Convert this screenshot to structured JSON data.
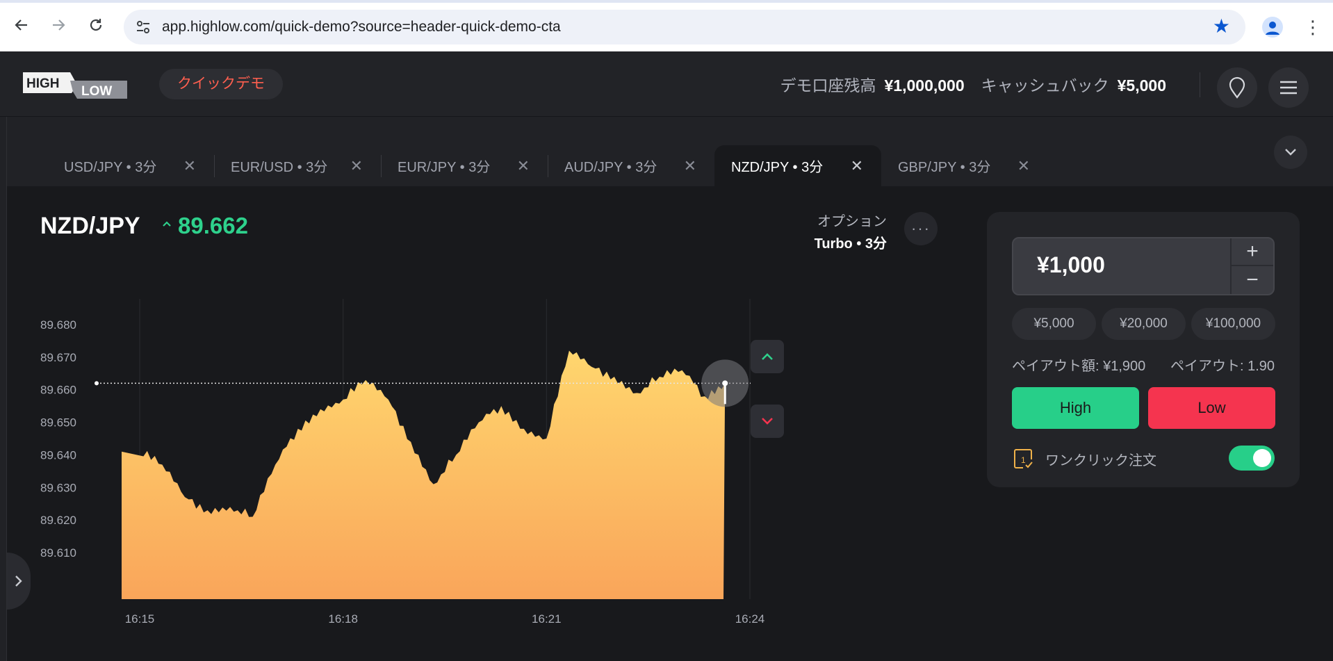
{
  "browser": {
    "url": "app.highlow.com/quick-demo?source=header-quick-demo-cta"
  },
  "header": {
    "logo_text_high": "HIGH",
    "logo_text_low": "LOW",
    "demo_label": "クイックデモ",
    "demo_balance_label": "デモ口座残高",
    "demo_balance_value": "¥1,000,000",
    "cashback_label": "キャッシュバック",
    "cashback_value": "¥5,000"
  },
  "tabs": [
    {
      "label": "USD/JPY • 3分",
      "active": false
    },
    {
      "label": "EUR/USD • 3分",
      "active": false
    },
    {
      "label": "EUR/JPY • 3分",
      "active": false
    },
    {
      "label": "AUD/JPY • 3分",
      "active": false
    },
    {
      "label": "NZD/JPY • 3分",
      "active": true
    },
    {
      "label": "GBP/JPY • 3分",
      "active": false
    }
  ],
  "asset": {
    "pair": "NZD/JPY",
    "price": "89.662",
    "option_label": "オプション",
    "option_value": "Turbo • 3分"
  },
  "chart_data": {
    "type": "area",
    "xlabel": "",
    "ylabel": "",
    "x_ticks": [
      "16:15",
      "16:18",
      "16:21",
      "16:24"
    ],
    "y_ticks": [
      "89.680",
      "89.670",
      "89.660",
      "89.650",
      "89.640",
      "89.630",
      "89.620",
      "89.610"
    ],
    "ylim": [
      89.6,
      89.685
    ],
    "current_price_line": 89.662,
    "series": [
      {
        "x": [
          "16:15:00",
          "16:15:20",
          "16:15:40",
          "16:16:00",
          "16:16:20",
          "16:16:40",
          "16:17:00",
          "16:17:20",
          "16:17:40",
          "16:18:00",
          "16:18:20",
          "16:18:40",
          "16:19:00",
          "16:19:20",
          "16:19:40",
          "16:20:00",
          "16:20:20",
          "16:20:40",
          "16:21:00",
          "16:21:20",
          "16:21:40",
          "16:22:00",
          "16:22:20",
          "16:22:40",
          "16:23:00",
          "16:23:20",
          "16:23:38"
        ],
        "values": [
          89.641,
          89.637,
          89.627,
          89.623,
          89.624,
          89.621,
          89.637,
          89.648,
          89.654,
          89.657,
          89.663,
          89.657,
          89.644,
          89.631,
          89.64,
          89.65,
          89.655,
          89.648,
          89.645,
          89.672,
          89.667,
          89.664,
          89.659,
          89.664,
          89.666,
          89.658,
          89.662
        ]
      }
    ],
    "grid": false,
    "legend": "none"
  },
  "trade": {
    "amount": "¥1,000",
    "plus": "+",
    "minus": "−",
    "presets": [
      "¥5,000",
      "¥20,000",
      "¥100,000"
    ],
    "payout_amount": "ペイアウト額: ¥1,900",
    "payout_rate": "ペイアウト: 1.90",
    "high_label": "High",
    "low_label": "Low",
    "one_click_label": "ワンクリック注文",
    "one_click_enabled": true,
    "one_click_icon_digit": "1"
  },
  "colors": {
    "up": "#2ed18c",
    "down": "#f5344f",
    "area_top": "#ffd66e",
    "area_bottom": "#f9a55a",
    "brand_demo": "#ff5f4f"
  }
}
